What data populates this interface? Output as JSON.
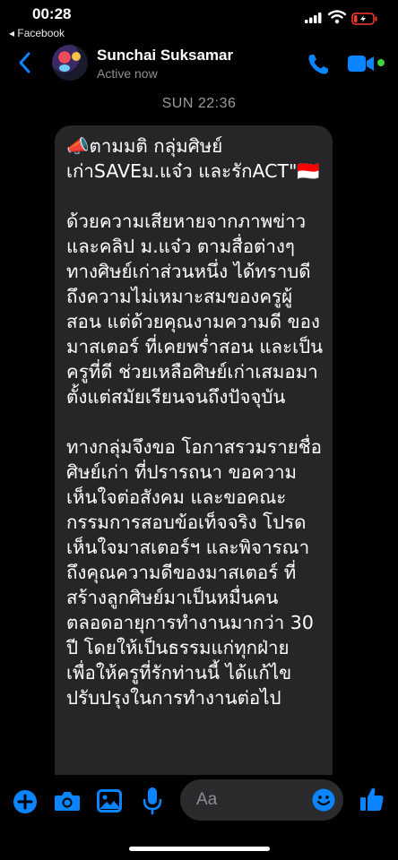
{
  "status_bar": {
    "time": "00:28",
    "back_app": "◂ Facebook"
  },
  "header": {
    "contact_name": "Sunchai Suksamar",
    "status": "Active now"
  },
  "conversation": {
    "date_stamp": "SUN 22:36",
    "message_text": "📣ตามมติ กลุ่มศิษย์เก่าSAVEม.แจ๋ว และรักACT\"🇮🇩\n\nด้วยความเสียหายจากภาพข่าว และคลิป ม.แจ๋ว ตามสื่อต่างๆ ทางศิษย์เก่าส่วนหนึ่ง ได้ทราบดีถึงความไม่เหมาะสมของครูผู้สอน แต่ด้วยคุณงามความดี ของมาสเตอร์ ที่เคยพร่ำสอน และเป็นครูที่ดี ช่วยเหลือศิษย์เก่าเสมอมา ตั้งแต่สมัยเรียนจนถึงปัจจุบัน\n\nทางกลุ่มจึงขอ โอกาสรวมรายชื่อ ศิษย์เก่า ที่ปรารถนา ขอความเห็นใจต่อสังคม และขอคณะกรรมการสอบข้อเท็จจริง โปรดเห็นใจมาสเตอร์ฯ และพิจารณาถึงคุณความดีของมาสเตอร์ ที่สร้างลูกศิษย์มาเป็นหมื่นคนตลอดอายุการทำงานมากว่า 30 ปี โดยให้เป็นธรรมแก่ทุกฝ่าย เพื่อให้ครูที่รักท่านนี้ ได้แก้ไข ปรับปรุงในการทำงานต่อไป"
  },
  "composer": {
    "placeholder": "Aa"
  },
  "colors": {
    "accent": "#0a84ff",
    "bubble": "#262629",
    "background": "#000000",
    "online": "#3fd23f"
  },
  "icons": {
    "plus": "plus-circle-icon",
    "camera": "camera-icon",
    "gallery": "image-icon",
    "mic": "microphone-icon",
    "emoji": "smiley-icon",
    "like": "thumbs-up-icon",
    "call": "phone-icon",
    "video": "video-camera-icon"
  }
}
